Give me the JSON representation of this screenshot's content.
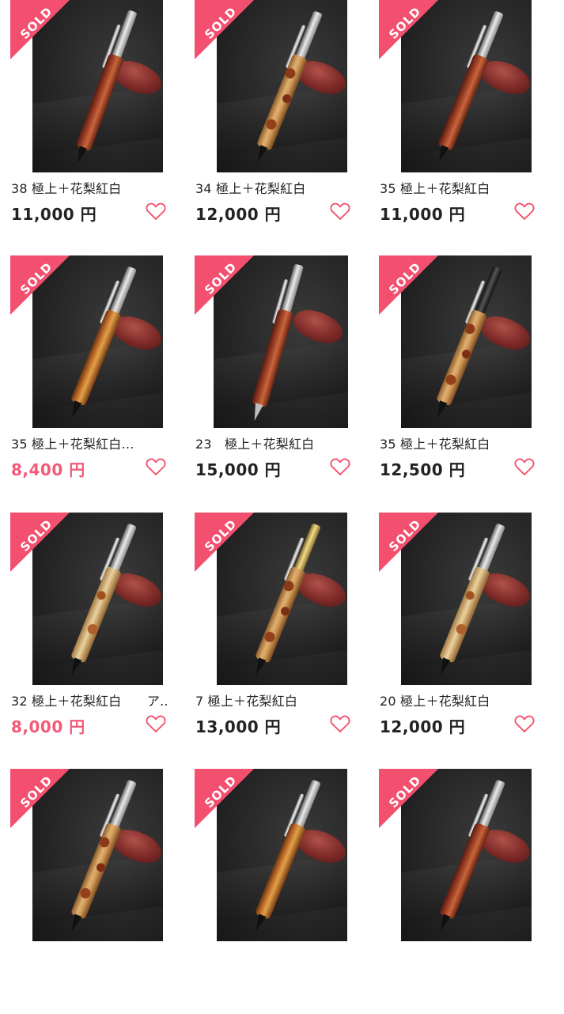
{
  "sold_label": "SOLD",
  "accent_pink": "#f2506e",
  "price_red": "#f25a79",
  "products": [
    {
      "title": "38 極上＋花梨紅白",
      "price": "11,000 円",
      "price_sale": false,
      "sold": true
    },
    {
      "title": "34 極上＋花梨紅白",
      "price": "12,000 円",
      "price_sale": false,
      "sold": true
    },
    {
      "title": "35 極上＋花梨紅白",
      "price": "11,000 円",
      "price_sale": false,
      "sold": true
    },
    {
      "title": "35 極上＋花梨紅白…",
      "price": "8,400 円",
      "price_sale": true,
      "sold": true
    },
    {
      "title": "23　極上＋花梨紅白",
      "price": "15,000 円",
      "price_sale": false,
      "sold": true
    },
    {
      "title": "35 極上＋花梨紅白",
      "price": "12,500 円",
      "price_sale": false,
      "sold": true
    },
    {
      "title": "32 極上＋花梨紅白　　ア…",
      "price": "8,000 円",
      "price_sale": true,
      "sold": true
    },
    {
      "title": "7 極上＋花梨紅白",
      "price": "13,000 円",
      "price_sale": false,
      "sold": true
    },
    {
      "title": "20 極上＋花梨紅白",
      "price": "12,000 円",
      "price_sale": false,
      "sold": true
    },
    {
      "title": "",
      "price": "",
      "price_sale": false,
      "sold": true
    },
    {
      "title": "",
      "price": "",
      "price_sale": false,
      "sold": true
    },
    {
      "title": "",
      "price": "",
      "price_sale": false,
      "sold": true
    }
  ],
  "icons": {
    "favorite": "heart-outline-icon"
  }
}
